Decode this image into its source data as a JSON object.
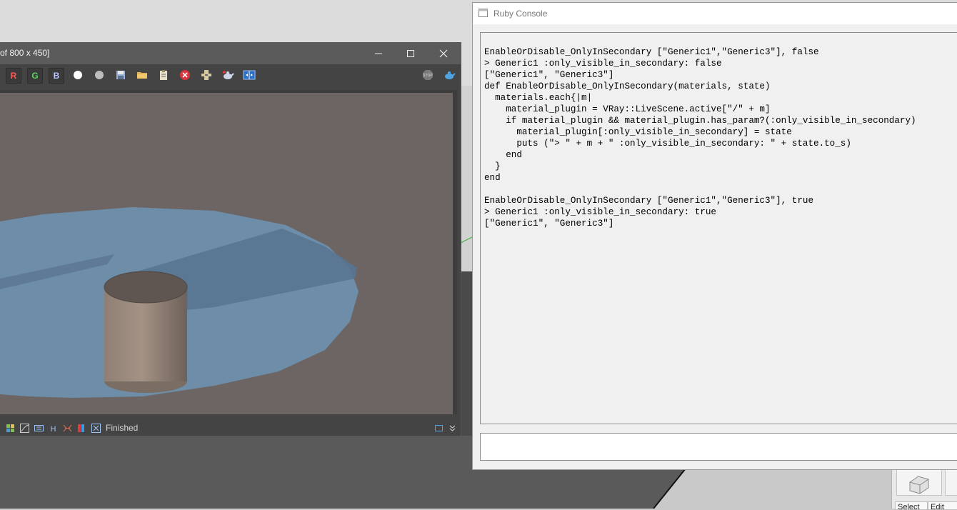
{
  "vfb": {
    "title": "of 800 x 450]",
    "channels": {
      "r": "R",
      "g": "G",
      "b": "B"
    },
    "toolbar_icons": [
      "white-sphere-icon",
      "gray-sphere-icon",
      "save-icon",
      "open-folder-icon",
      "clipboard-icon",
      "clear-image-icon",
      "region-render-icon",
      "teapot-render-icon",
      "compare-icon",
      "stop-icon",
      "interactive-render-icon"
    ],
    "status_text": "Finished",
    "colors": {
      "titlebar": "#5b5b5b",
      "panel": "#444444",
      "canvas": "#6c6563",
      "water": "#6f8fac",
      "cylinder": "#9b8a7e"
    }
  },
  "ruby_console": {
    "title": "Ruby Console",
    "output_lines": [
      "EnableOrDisable_OnlyInSecondary [\"Generic1\",\"Generic3\"], false",
      "> Generic1 :only_visible_in_secondary: false",
      "[\"Generic1\", \"Generic3\"]",
      "def EnableOrDisable_OnlyInSecondary(materials, state)",
      "  materials.each{|m|",
      "    material_plugin = VRay::LiveScene.active[\"/\" + m]",
      "    if material_plugin && material_plugin.has_param?(:only_visible_in_secondary)",
      "      material_plugin[:only_visible_in_secondary] = state",
      "      puts (\"> \" + m + \" :only_visible_in_secondary: \" + state.to_s)",
      "    end",
      "  }",
      "end",
      "",
      "EnableOrDisable_OnlyInSecondary [\"Generic1\",\"Generic3\"], true",
      "> Generic1 :only_visible_in_secondary: true",
      "[\"Generic1\", \"Generic3\"]"
    ],
    "input_value": ""
  },
  "tray": {
    "tab1": "Select",
    "tab2": "Edit"
  }
}
